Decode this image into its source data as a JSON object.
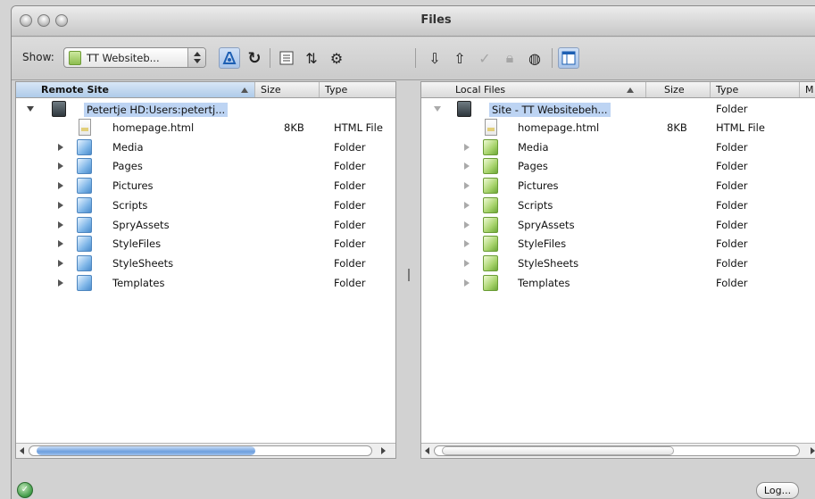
{
  "window": {
    "title": "Files"
  },
  "toolbar": {
    "show_label": "Show:",
    "site_select": "TT Websiteb...",
    "icons": [
      "connect-icon",
      "refresh-icon",
      "expand-icon",
      "sync-icon",
      "checkout-icon",
      "get-icon",
      "put-icon",
      "check-in-icon",
      "check-out-icon",
      "globe-icon",
      "view-toggle-icon"
    ]
  },
  "remote": {
    "columns": {
      "name": "Remote Site",
      "size": "Size",
      "type": "Type"
    },
    "root": {
      "name": "Petertje HD:Users:petertj..."
    },
    "items": [
      {
        "name": "homepage.html",
        "size": "8KB",
        "type": "HTML File",
        "kind": "file"
      },
      {
        "name": "Media",
        "size": "",
        "type": "Folder",
        "kind": "folder"
      },
      {
        "name": "Pages",
        "size": "",
        "type": "Folder",
        "kind": "folder"
      },
      {
        "name": "Pictures",
        "size": "",
        "type": "Folder",
        "kind": "folder"
      },
      {
        "name": "Scripts",
        "size": "",
        "type": "Folder",
        "kind": "folder"
      },
      {
        "name": "SpryAssets",
        "size": "",
        "type": "Folder",
        "kind": "folder"
      },
      {
        "name": "StyleFiles",
        "size": "",
        "type": "Folder",
        "kind": "folder"
      },
      {
        "name": "StyleSheets",
        "size": "",
        "type": "Folder",
        "kind": "folder"
      },
      {
        "name": "Templates",
        "size": "",
        "type": "Folder",
        "kind": "folder"
      }
    ]
  },
  "local": {
    "columns": {
      "name": "Local Files",
      "size": "Size",
      "type": "Type",
      "modified": "M"
    },
    "root": {
      "name": "Site - TT Websitebeh...",
      "type": "Folder"
    },
    "items": [
      {
        "name": "homepage.html",
        "size": "8KB",
        "type": "HTML File",
        "kind": "file"
      },
      {
        "name": "Media",
        "size": "",
        "type": "Folder",
        "kind": "folder"
      },
      {
        "name": "Pages",
        "size": "",
        "type": "Folder",
        "kind": "folder"
      },
      {
        "name": "Pictures",
        "size": "",
        "type": "Folder",
        "kind": "folder"
      },
      {
        "name": "Scripts",
        "size": "",
        "type": "Folder",
        "kind": "folder"
      },
      {
        "name": "SpryAssets",
        "size": "",
        "type": "Folder",
        "kind": "folder"
      },
      {
        "name": "StyleFiles",
        "size": "",
        "type": "Folder",
        "kind": "folder"
      },
      {
        "name": "StyleSheets",
        "size": "",
        "type": "Folder",
        "kind": "folder"
      },
      {
        "name": "Templates",
        "size": "",
        "type": "Folder",
        "kind": "folder"
      }
    ]
  },
  "status": {
    "log_button": "Log..."
  },
  "colors": {
    "selection": "#bdd4f3",
    "pressed": "#a9c4e8",
    "remote_folder": "#7fb6e8",
    "local_folder": "#a7d36b"
  }
}
